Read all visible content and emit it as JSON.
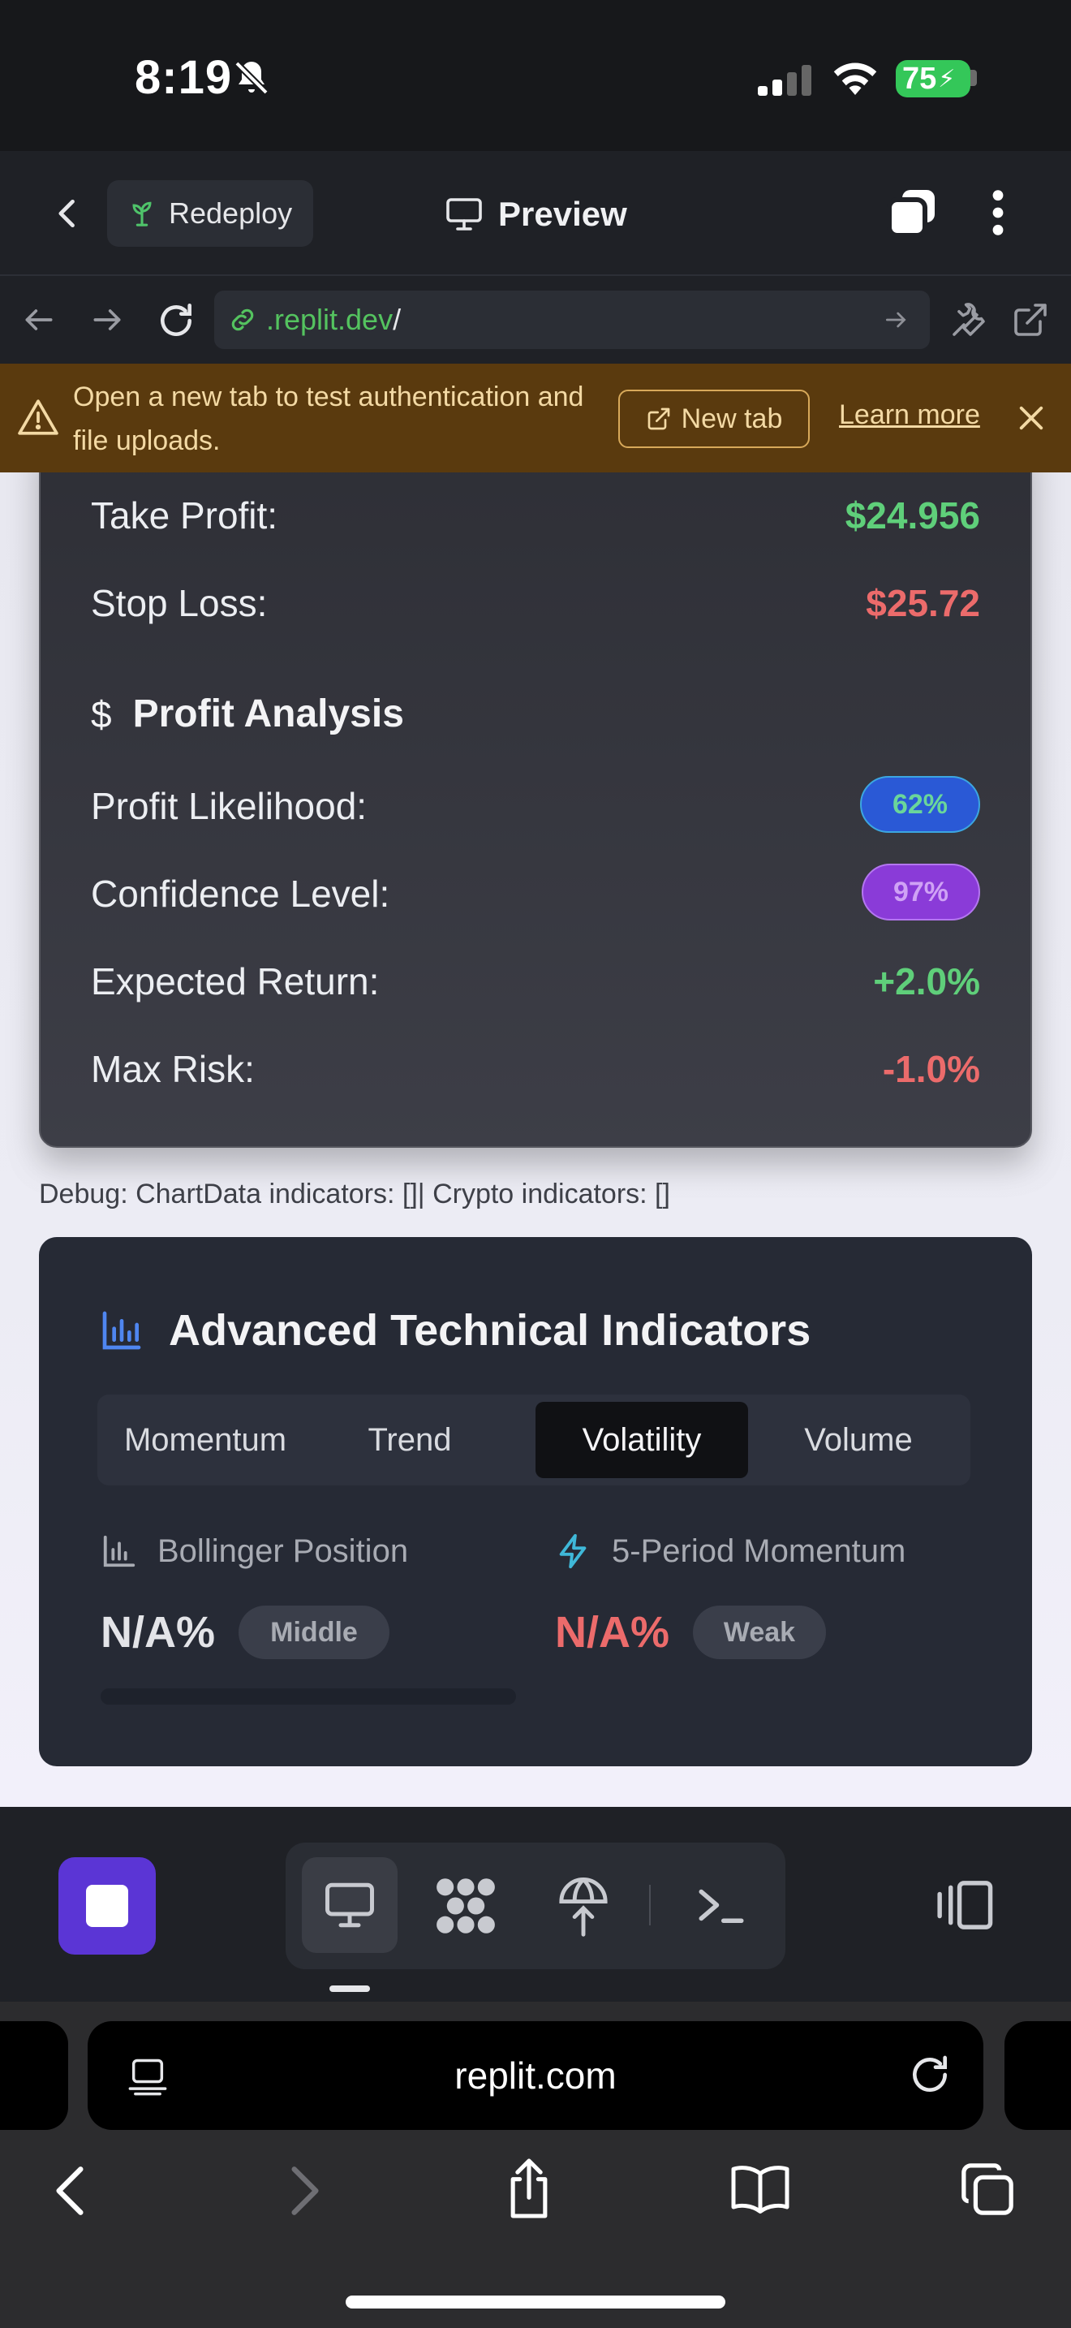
{
  "status": {
    "time": "8:19",
    "battery": "75"
  },
  "header": {
    "redeploy_label": "Redeploy",
    "preview_label": "Preview"
  },
  "address": {
    "url_host": ".replit.dev",
    "url_path": "/"
  },
  "banner": {
    "message": "Open a new tab to test authentication and file uploads.",
    "new_tab_label": "New tab",
    "learn_more_label": "Learn more"
  },
  "trade": {
    "take_profit_label": "Take Profit:",
    "take_profit_value": "$24.956",
    "stop_loss_label": "Stop Loss:",
    "stop_loss_value": "$25.72"
  },
  "profit_analysis": {
    "icon_glyph": "$",
    "title": "Profit Analysis",
    "likelihood_label": "Profit Likelihood:",
    "likelihood_value": "62%",
    "confidence_label": "Confidence Level:",
    "confidence_value": "97%",
    "expected_return_label": "Expected Return:",
    "expected_return_value": "+2.0%",
    "max_risk_label": "Max Risk:",
    "max_risk_value": "-1.0%"
  },
  "debug_text": "Debug: ChartData indicators: []| Crypto indicators: []",
  "indicators": {
    "title": "Advanced Technical Indicators",
    "tabs": [
      "Momentum",
      "Trend",
      "Volatility",
      "Volume"
    ],
    "active_tab": "Volatility",
    "bollinger_label": "Bollinger Position",
    "bollinger_value": "N/A%",
    "bollinger_tag": "Middle",
    "momentum_label": "5-Period Momentum",
    "momentum_value": "N/A%",
    "momentum_tag": "Weak",
    "bollinger_progress_percent": 0
  },
  "browser": {
    "domain": "replit.com"
  },
  "colors": {
    "accent_purple": "#5b35d5",
    "positive": "#5fcf7a",
    "negative": "#ec6b6b",
    "warning_bg": "#5a3a0e"
  },
  "icons": [
    "bell-slash-icon",
    "signal-icon",
    "wifi-icon",
    "battery-icon",
    "chevron-left-icon",
    "sprout-icon",
    "monitor-icon",
    "tabs-icon",
    "more-vertical-icon",
    "back-arrow-icon",
    "forward-arrow-icon",
    "reload-icon",
    "link-icon",
    "arrow-right-icon",
    "wrench-icon",
    "external-link-icon",
    "warning-icon",
    "close-icon",
    "dollar-icon",
    "bar-chart-icon",
    "lightning-icon",
    "stop-icon",
    "desktop-icon",
    "apps-icon",
    "deploy-icon",
    "terminal-icon",
    "panel-icon",
    "reader-icon",
    "share-icon",
    "book-icon",
    "tabs-overview-icon"
  ]
}
